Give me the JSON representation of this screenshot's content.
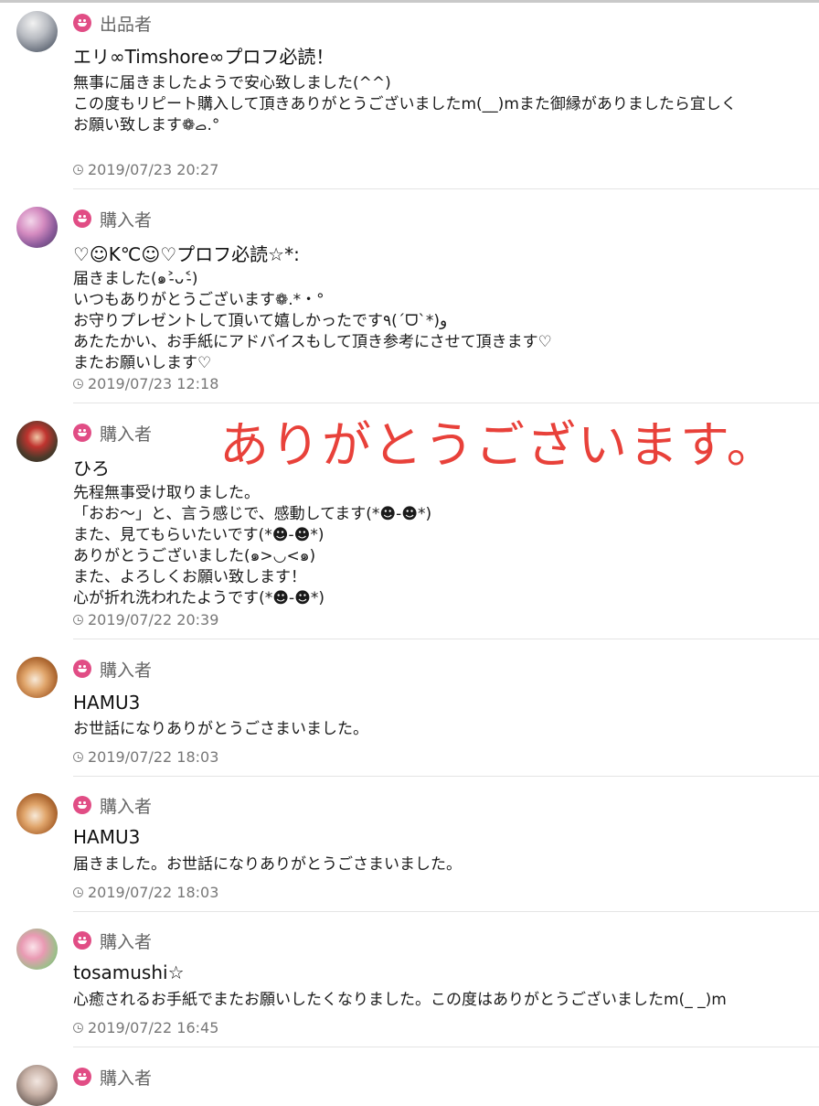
{
  "colors": {
    "seller_icon": "#e14d85",
    "buyer_icon": "#e14d85",
    "overlay_text": "#e8413a",
    "separator": "#e4e4e4"
  },
  "overlay_text": "ありがとうございます。",
  "reviews": [
    {
      "role": "出品者",
      "name": "エリ∞Timshore∞プロフ必読！",
      "lines": [
        "無事に届きましたようで安心致しました(^^)",
        "この度もリピート購入して頂きありがとうございましたm(__)mまた御縁がありましたら宜しく",
        "お願い致します❁ࡇ.°"
      ],
      "date": "2019/07/23 20:27",
      "avatar": "cloud-sky-photo"
    },
    {
      "role": "購入者",
      "name": "♡☺K℃☺♡プロフ必読☆*:",
      "lines": [
        "届きました(๑˃̵ᴗ˂̵)",
        "いつもありがとうございます❁.*・°",
        "お守りプレゼントして頂いて嬉しかったです٩(ˊᗜˋ*)و",
        "あたたかい、お手紙にアドバイスもして頂き参考にさせて頂きます♡",
        "またお願いします♡"
      ],
      "date": "2019/07/23 12:18",
      "avatar": "flower-photo"
    },
    {
      "role": "購入者",
      "name": "ひろ",
      "lines": [
        "先程無事受け取りました。",
        "「おお〜」と、言う感じで、感動してます(*☻-☻*)",
        "また、見てもらいたいです(*☻-☻*)",
        "ありがとうございました(๑>◡<๑)",
        "また、よろしくお願い致します！",
        "心が折れ洗われたようです(*☻-☻*)"
      ],
      "date": "2019/07/22 20:39",
      "avatar": "doll-photo"
    },
    {
      "role": "購入者",
      "name": "HAMU3",
      "lines": [
        "お世話になりありがとうごさまいました。"
      ],
      "date": "2019/07/22 18:03",
      "avatar": "hamster-photo"
    },
    {
      "role": "購入者",
      "name": "HAMU3",
      "lines": [
        "届きました。お世話になりありがとうごさまいました。"
      ],
      "date": "2019/07/22 18:03",
      "avatar": "hamster-photo"
    },
    {
      "role": "購入者",
      "name": "tosamushi☆",
      "lines": [
        "心癒されるお手紙でまたお願いしたくなりました。この度はありがとうございましたm(_ _)m"
      ],
      "date": "2019/07/22 16:45",
      "avatar": "pink-flower-photo"
    },
    {
      "role": "購入者",
      "name": "",
      "lines": [],
      "date": "",
      "avatar": "doll-photo"
    }
  ]
}
